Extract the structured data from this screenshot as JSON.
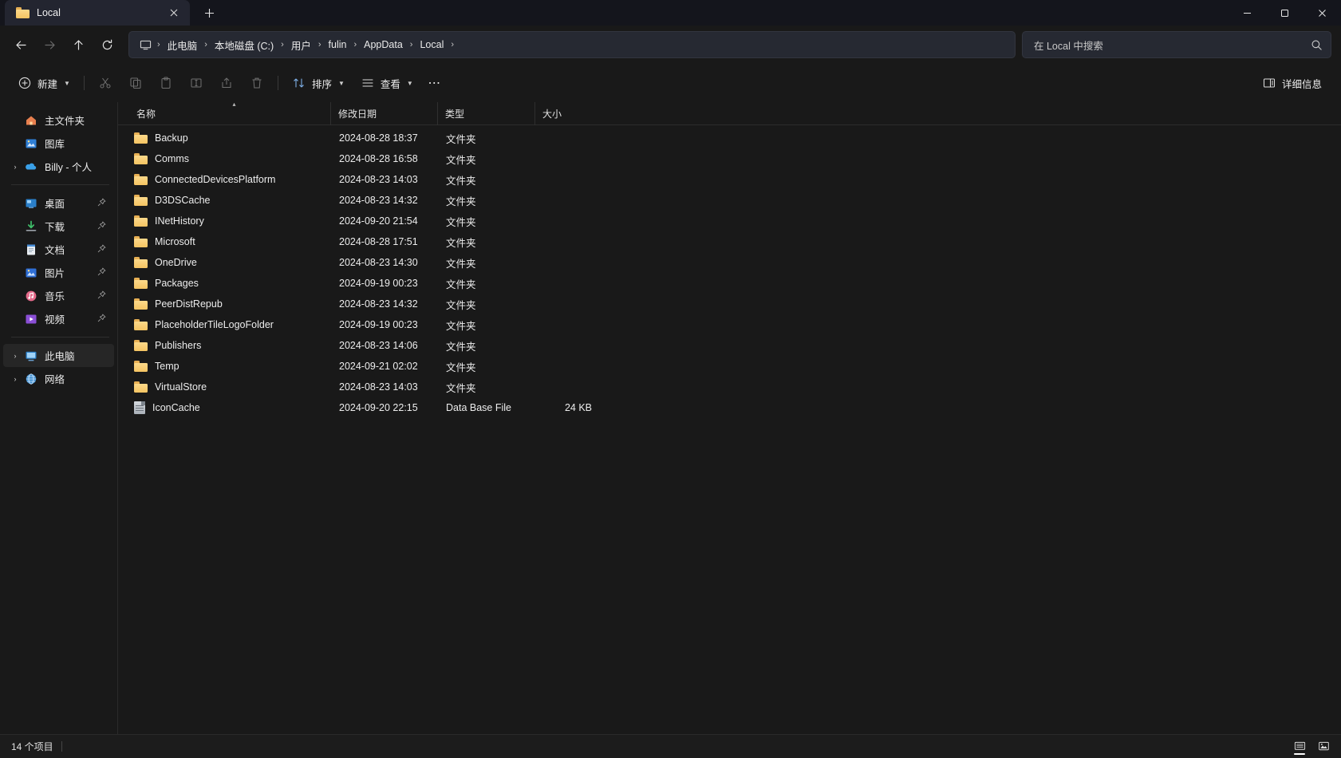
{
  "window": {
    "tab": {
      "title": "Local",
      "icon": "folder-icon",
      "close_label": "✕"
    },
    "newtab_label": "+",
    "controls": {
      "minimize": "minimize-icon",
      "maximize": "maximize-icon",
      "close": "close-icon"
    }
  },
  "nav": {
    "back": "←",
    "forward": "→",
    "up": "↑",
    "refresh": "↻",
    "breadcrumb": {
      "home_icon": "this-pc-icon",
      "items": [
        {
          "label": "此电脑"
        },
        {
          "label": "本地磁盘 (C:)"
        },
        {
          "label": "用户"
        },
        {
          "label": "fulin"
        },
        {
          "label": "AppData"
        },
        {
          "label": "Local"
        }
      ],
      "separator": "›"
    },
    "search": {
      "placeholder": "在 Local 中搜索",
      "value": "",
      "icon": "search-icon"
    }
  },
  "toolbar": {
    "new_label": "新建",
    "cut_label": "剪切",
    "copy_label": "复制",
    "paste_label": "粘贴",
    "rename_label": "重命名",
    "share_label": "共享",
    "delete_label": "删除",
    "sort_label": "排序",
    "view_label": "查看",
    "more_label": "⋯",
    "details_label": "详细信息",
    "chevron": "⌄"
  },
  "sidebar": {
    "groups": [
      {
        "items": [
          {
            "label": "主文件夹",
            "icon": "home-icon",
            "expander": false,
            "pin": false,
            "selected": false
          },
          {
            "label": "图库",
            "icon": "gallery-icon",
            "expander": false,
            "pin": false,
            "selected": false
          },
          {
            "label": "Billy - 个人",
            "icon": "onedrive-icon",
            "expander": true,
            "pin": false,
            "selected": false
          }
        ]
      },
      {
        "items": [
          {
            "label": "桌面",
            "icon": "desktop-icon",
            "expander": false,
            "pin": true,
            "selected": false
          },
          {
            "label": "下载",
            "icon": "downloads-icon",
            "expander": false,
            "pin": true,
            "selected": false
          },
          {
            "label": "文档",
            "icon": "documents-icon",
            "expander": false,
            "pin": true,
            "selected": false
          },
          {
            "label": "图片",
            "icon": "pictures-icon",
            "expander": false,
            "pin": true,
            "selected": false
          },
          {
            "label": "音乐",
            "icon": "music-icon",
            "expander": false,
            "pin": true,
            "selected": false
          },
          {
            "label": "视频",
            "icon": "videos-icon",
            "expander": false,
            "pin": true,
            "selected": false
          }
        ]
      },
      {
        "items": [
          {
            "label": "此电脑",
            "icon": "this-pc-icon",
            "expander": true,
            "pin": false,
            "selected": true
          },
          {
            "label": "网络",
            "icon": "network-icon",
            "expander": true,
            "pin": false,
            "selected": false
          }
        ]
      }
    ],
    "pin_glyph": "📌",
    "expander_glyph": "›"
  },
  "filelist": {
    "columns": [
      {
        "key": "name",
        "label": "名称",
        "sorted": "asc"
      },
      {
        "key": "date",
        "label": "修改日期",
        "sorted": ""
      },
      {
        "key": "type",
        "label": "类型",
        "sorted": ""
      },
      {
        "key": "size",
        "label": "大小",
        "sorted": ""
      }
    ],
    "sort_asc_glyph": "▴",
    "rows": [
      {
        "name": "Backup",
        "date": "2024-08-28 18:37",
        "type": "文件夹",
        "size": "",
        "icon": "folder-icon"
      },
      {
        "name": "Comms",
        "date": "2024-08-28 16:58",
        "type": "文件夹",
        "size": "",
        "icon": "folder-icon"
      },
      {
        "name": "ConnectedDevicesPlatform",
        "date": "2024-08-23 14:03",
        "type": "文件夹",
        "size": "",
        "icon": "folder-icon"
      },
      {
        "name": "D3DSCache",
        "date": "2024-08-23 14:32",
        "type": "文件夹",
        "size": "",
        "icon": "folder-icon"
      },
      {
        "name": "INetHistory",
        "date": "2024-09-20 21:54",
        "type": "文件夹",
        "size": "",
        "icon": "folder-icon"
      },
      {
        "name": "Microsoft",
        "date": "2024-08-28 17:51",
        "type": "文件夹",
        "size": "",
        "icon": "folder-icon"
      },
      {
        "name": "OneDrive",
        "date": "2024-08-23 14:30",
        "type": "文件夹",
        "size": "",
        "icon": "folder-icon"
      },
      {
        "name": "Packages",
        "date": "2024-09-19 00:23",
        "type": "文件夹",
        "size": "",
        "icon": "folder-icon"
      },
      {
        "name": "PeerDistRepub",
        "date": "2024-08-23 14:32",
        "type": "文件夹",
        "size": "",
        "icon": "folder-icon"
      },
      {
        "name": "PlaceholderTileLogoFolder",
        "date": "2024-09-19 00:23",
        "type": "文件夹",
        "size": "",
        "icon": "folder-icon"
      },
      {
        "name": "Publishers",
        "date": "2024-08-23 14:06",
        "type": "文件夹",
        "size": "",
        "icon": "folder-icon"
      },
      {
        "name": "Temp",
        "date": "2024-09-21 02:02",
        "type": "文件夹",
        "size": "",
        "icon": "folder-icon"
      },
      {
        "name": "VirtualStore",
        "date": "2024-08-23 14:03",
        "type": "文件夹",
        "size": "",
        "icon": "folder-icon"
      },
      {
        "name": "IconCache",
        "date": "2024-09-20 22:15",
        "type": "Data Base File",
        "size": "24 KB",
        "icon": "database-file-icon"
      }
    ]
  },
  "statusbar": {
    "items_count": "14 个项目",
    "details_view": "details-view-icon",
    "large_icons_view": "large-icons-view-icon"
  },
  "colors": {
    "window_bg": "#191919",
    "titlebar_bg": "#14151c",
    "tab_bg": "#232530",
    "field_bg": "#262932",
    "folder_yellow": "#f5c462",
    "accent": "#4cc2ff"
  }
}
